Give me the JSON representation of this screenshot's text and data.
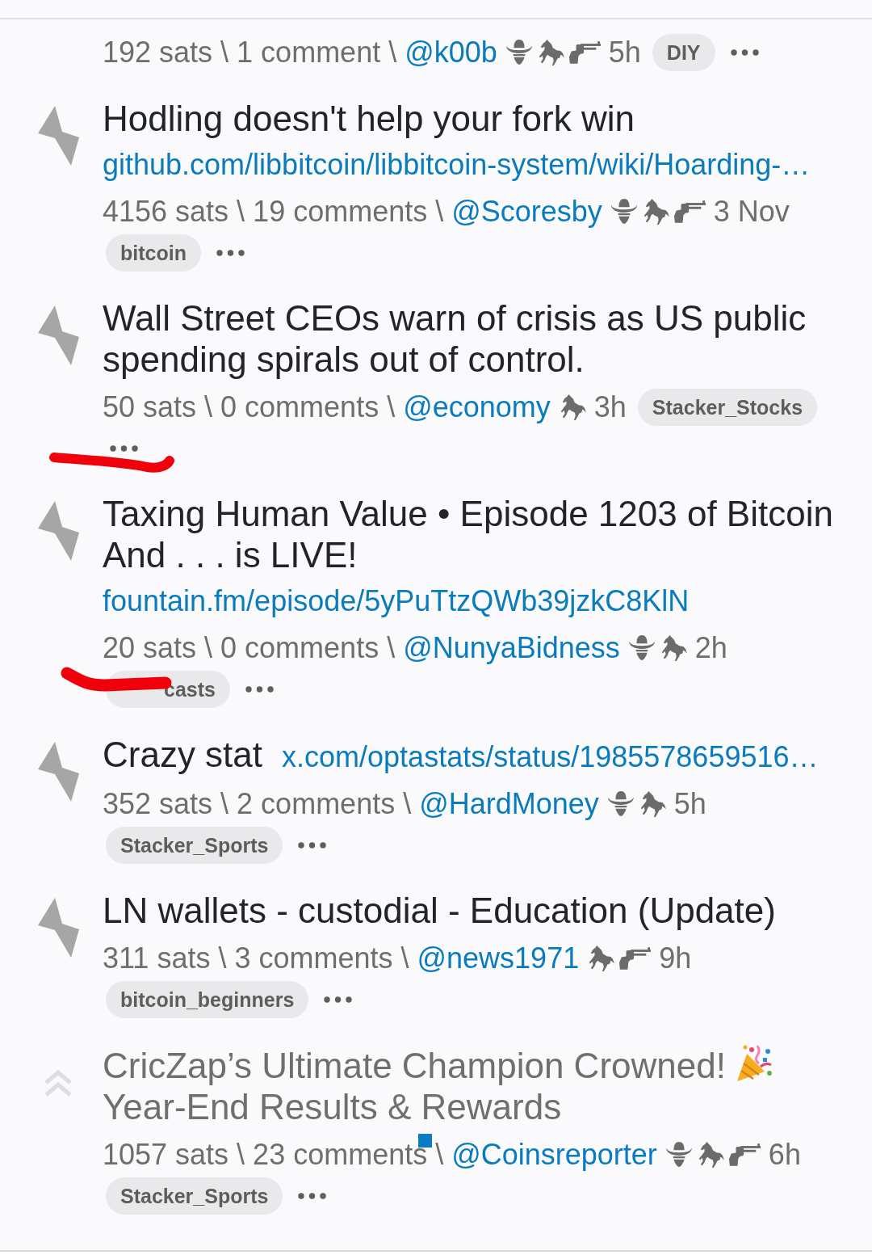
{
  "feed": {
    "items": [
      {
        "meta": {
          "stats": "192 sats \\ 1 comment \\",
          "user": "@k00b",
          "badges": [
            {
              "kind": "hat"
            },
            {
              "kind": "horse"
            },
            {
              "kind": "gun"
            }
          ],
          "age": "5h",
          "tag": "DIY"
        }
      },
      {
        "upvote": {
          "kind": "bolt"
        },
        "title": "Hodling doesn't help your fork win",
        "dimmed": false,
        "link": "github.com/libbitcoin/libbitcoin-system/wiki/Hoarding-…",
        "meta": {
          "stats": "4156 sats \\ 19 comments \\",
          "user": "@Scoresby",
          "badges": [
            {
              "kind": "hat"
            },
            {
              "kind": "horse"
            },
            {
              "kind": "gun"
            }
          ],
          "age": "3 Nov",
          "tag": "bitcoin"
        }
      },
      {
        "upvote": {
          "kind": "bolt"
        },
        "title": "Wall Street CEOs warn of crisis as US public spending spirals out of control.",
        "dimmed": false,
        "meta": {
          "stats": "50 sats \\ 0 comments \\",
          "user": "@economy",
          "badges": [
            {
              "kind": "horse"
            }
          ],
          "age": "3h",
          "tag": "Stacker_Stocks",
          "more_scribbled": true
        }
      },
      {
        "upvote": {
          "kind": "bolt"
        },
        "title": "Taxing Human Value • Episode 1203 of Bitcoin And . . . is LIVE!",
        "dimmed": false,
        "link": "fountain.fm/episode/5yPuTtzQWb39jzkC8KlN",
        "meta": {
          "stats": "20 sats \\ 0 comments \\",
          "user": "@NunyaBidness",
          "badges": [
            {
              "kind": "hat"
            },
            {
              "kind": "horse"
            }
          ],
          "age": "2h",
          "tag": "casts",
          "tag_scribbled": true
        }
      },
      {
        "upvote": {
          "kind": "bolt"
        },
        "title": "Crazy stat",
        "dimmed": false,
        "link": "x.com/optastats/status/1985578659516…",
        "meta": {
          "stats": "352 sats \\ 2 comments \\",
          "user": "@HardMoney",
          "badges": [
            {
              "kind": "hat"
            },
            {
              "kind": "horse"
            }
          ],
          "age": "5h",
          "tag": "Stacker_Sports"
        }
      },
      {
        "upvote": {
          "kind": "bolt"
        },
        "title": "LN wallets - custodial - Education (Update)",
        "dimmed": false,
        "meta": {
          "stats": "311 sats \\ 3 comments \\",
          "user": "@news1971",
          "badges": [
            {
              "kind": "horse"
            },
            {
              "kind": "gun"
            }
          ],
          "age": "9h",
          "tag": "bitcoin_beginners"
        }
      },
      {
        "upvote": {
          "kind": "chevron"
        },
        "title_parts": [
          {
            "kind": "text",
            "text": "CricZap’s Ultimate Champion Crowned!"
          },
          {
            "kind": "emoji"
          },
          {
            "kind": "text",
            "text": "Year-End Results & Rewards"
          }
        ],
        "dimmed": true,
        "meta": {
          "stats": "1057 sats \\ 23 comments \\",
          "marker": true,
          "user": "@Coinsreporter",
          "badges": [
            {
              "kind": "hat"
            },
            {
              "kind": "horse"
            },
            {
              "kind": "gun"
            }
          ],
          "age": "6h",
          "tag": "Stacker_Sports"
        }
      }
    ]
  }
}
